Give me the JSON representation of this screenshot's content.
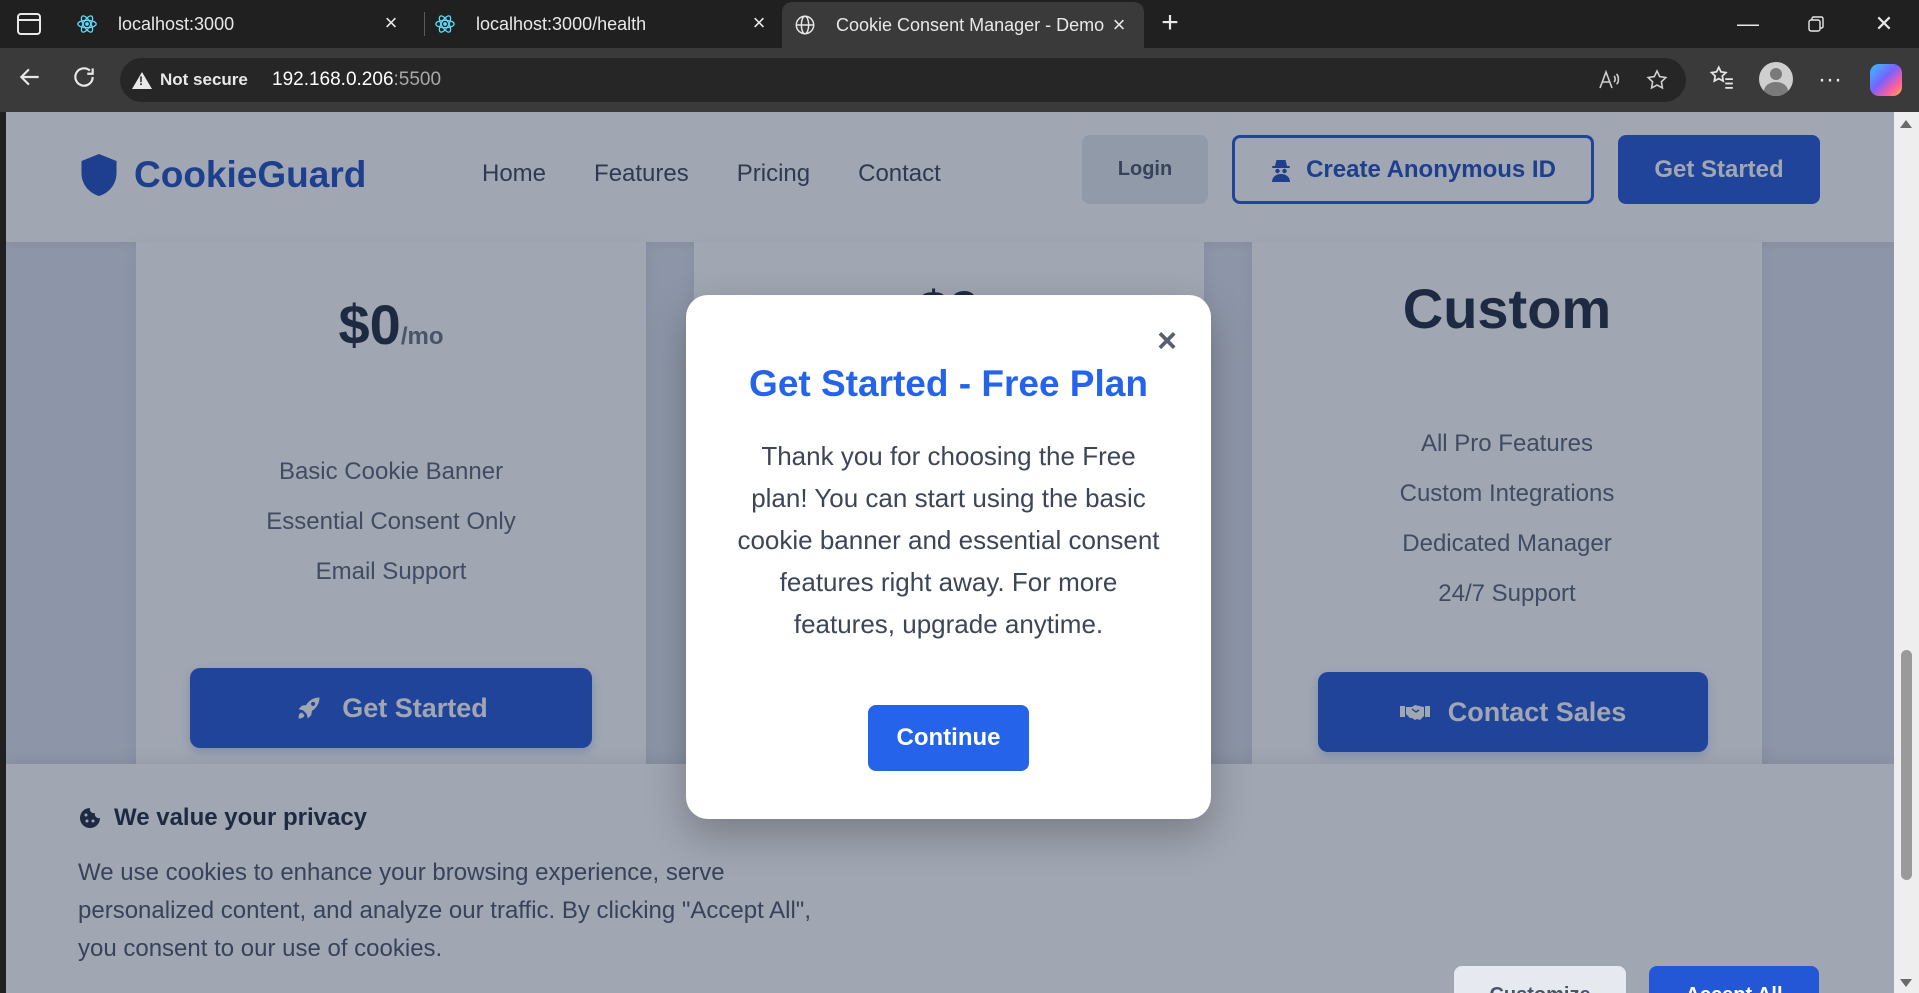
{
  "browser": {
    "tabs": [
      {
        "label": "localhost:3000",
        "icon": "react-icon"
      },
      {
        "label": "localhost:3000/health",
        "icon": "react-icon"
      },
      {
        "label": "Cookie Consent Manager - Demo",
        "icon": "globe-icon",
        "active": true
      }
    ],
    "security_label": "Not secure",
    "url_host": "192.168.0.206",
    "url_port": ":5500"
  },
  "header": {
    "brand": "CookieGuard",
    "nav": [
      "Home",
      "Features",
      "Pricing",
      "Contact"
    ],
    "login_label": "Login",
    "anon_label": "Create Anonymous ID",
    "get_started_label": "Get Started"
  },
  "pricing": {
    "free": {
      "price": "$0",
      "period": "/mo",
      "features": [
        "Basic Cookie Banner",
        "Essential Consent Only",
        "Email Support"
      ],
      "button": "Get Started"
    },
    "pro": {
      "price": "$9"
    },
    "enterprise": {
      "price": "Custom",
      "features": [
        "All Pro Features",
        "Custom Integrations",
        "Dedicated Manager",
        "24/7 Support"
      ],
      "button": "Contact Sales"
    }
  },
  "cookie_banner": {
    "title": "We value your privacy",
    "text": "We use cookies to enhance your browsing experience, serve personalized content, and analyze our traffic. By clicking \"Accept All\", you consent to our use of cookies.",
    "customize_label": "Customize",
    "accept_label": "Accept All"
  },
  "modal": {
    "title": "Get Started - Free Plan",
    "body": "Thank you for choosing the Free plan! You can start using the basic cookie banner and essential consent features right away. For more features, upgrade anytime.",
    "continue_label": "Continue"
  },
  "colors": {
    "primary": "#2457d6",
    "modal_title": "#2563eb",
    "browser_chrome": "#202020"
  }
}
